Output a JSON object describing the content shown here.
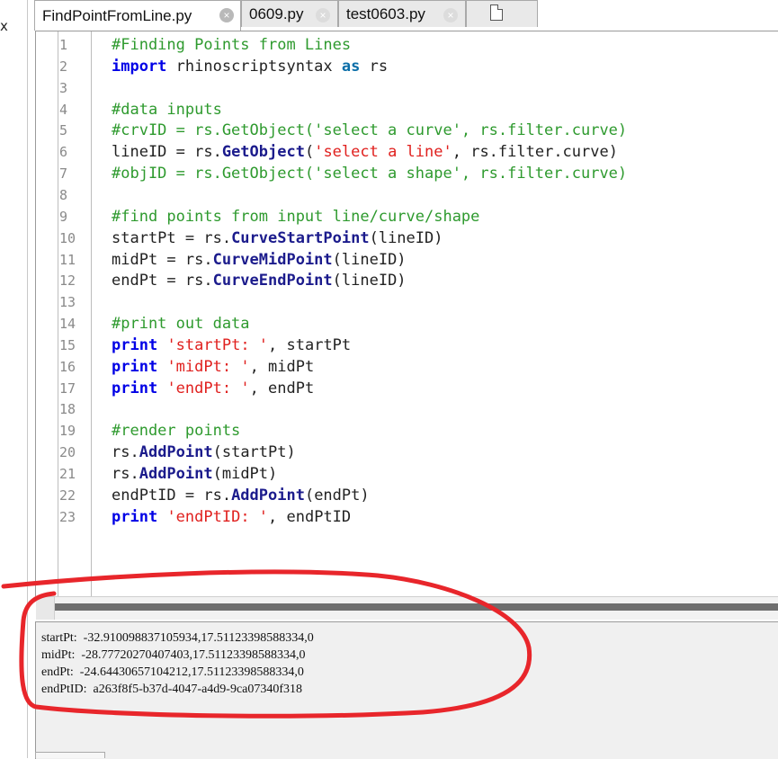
{
  "left_panel": {
    "close_glyph": "x"
  },
  "tabs": [
    {
      "label": "FindPointFromLine.py",
      "active": true
    },
    {
      "label": "0609.py",
      "active": false
    },
    {
      "label": "test0603.py",
      "active": false
    }
  ],
  "icons": {
    "tab_close": "close-circle-icon",
    "new_tab": "new-document-icon"
  },
  "editor": {
    "lines": [
      {
        "n": "1",
        "tokens": [
          {
            "t": "#Finding Points from Lines",
            "c": "cm"
          }
        ]
      },
      {
        "n": "2",
        "tokens": [
          {
            "t": "import",
            "c": "kw"
          },
          {
            "t": " rhinoscriptsyntax ",
            "c": "plain"
          },
          {
            "t": "as",
            "c": "kwb"
          },
          {
            "t": " rs",
            "c": "plain"
          }
        ]
      },
      {
        "n": "3",
        "tokens": []
      },
      {
        "n": "4",
        "tokens": [
          {
            "t": "#data inputs",
            "c": "cm"
          }
        ]
      },
      {
        "n": "5",
        "tokens": [
          {
            "t": "#crvID = rs.GetObject('select a curve', rs.filter.curve)",
            "c": "cm"
          }
        ]
      },
      {
        "n": "6",
        "tokens": [
          {
            "t": "lineID = rs.",
            "c": "plain"
          },
          {
            "t": "GetObject",
            "c": "fn"
          },
          {
            "t": "(",
            "c": "plain"
          },
          {
            "t": "'select a line'",
            "c": "str"
          },
          {
            "t": ", rs.filter.curve)",
            "c": "plain"
          }
        ]
      },
      {
        "n": "7",
        "tokens": [
          {
            "t": "#objID = rs.GetObject('select a shape', rs.filter.curve)",
            "c": "cm"
          }
        ]
      },
      {
        "n": "8",
        "tokens": []
      },
      {
        "n": "9",
        "tokens": [
          {
            "t": "#find points from input line/curve/shape",
            "c": "cm"
          }
        ]
      },
      {
        "n": "10",
        "tokens": [
          {
            "t": "startPt = rs.",
            "c": "plain"
          },
          {
            "t": "CurveStartPoint",
            "c": "fn"
          },
          {
            "t": "(lineID)",
            "c": "plain"
          }
        ]
      },
      {
        "n": "11",
        "tokens": [
          {
            "t": "midPt = rs.",
            "c": "plain"
          },
          {
            "t": "CurveMidPoint",
            "c": "fn"
          },
          {
            "t": "(lineID)",
            "c": "plain"
          }
        ]
      },
      {
        "n": "12",
        "tokens": [
          {
            "t": "endPt = rs.",
            "c": "plain"
          },
          {
            "t": "CurveEndPoint",
            "c": "fn"
          },
          {
            "t": "(lineID)",
            "c": "plain"
          }
        ]
      },
      {
        "n": "13",
        "tokens": []
      },
      {
        "n": "14",
        "tokens": [
          {
            "t": "#print out data",
            "c": "cm"
          }
        ]
      },
      {
        "n": "15",
        "tokens": [
          {
            "t": "print",
            "c": "kw"
          },
          {
            "t": " ",
            "c": "plain"
          },
          {
            "t": "'startPt: '",
            "c": "str"
          },
          {
            "t": ", startPt",
            "c": "plain"
          }
        ]
      },
      {
        "n": "16",
        "tokens": [
          {
            "t": "print",
            "c": "kw"
          },
          {
            "t": " ",
            "c": "plain"
          },
          {
            "t": "'midPt: '",
            "c": "str"
          },
          {
            "t": ", midPt",
            "c": "plain"
          }
        ]
      },
      {
        "n": "17",
        "tokens": [
          {
            "t": "print",
            "c": "kw"
          },
          {
            "t": " ",
            "c": "plain"
          },
          {
            "t": "'endPt: '",
            "c": "str"
          },
          {
            "t": ", endPt",
            "c": "plain"
          }
        ]
      },
      {
        "n": "18",
        "tokens": []
      },
      {
        "n": "19",
        "tokens": [
          {
            "t": "#render points",
            "c": "cm"
          }
        ]
      },
      {
        "n": "20",
        "tokens": [
          {
            "t": "rs.",
            "c": "plain"
          },
          {
            "t": "AddPoint",
            "c": "fn"
          },
          {
            "t": "(startPt)",
            "c": "plain"
          }
        ]
      },
      {
        "n": "21",
        "tokens": [
          {
            "t": "rs.",
            "c": "plain"
          },
          {
            "t": "AddPoint",
            "c": "fn"
          },
          {
            "t": "(midPt)",
            "c": "plain"
          }
        ]
      },
      {
        "n": "22",
        "tokens": [
          {
            "t": "endPtID = rs.",
            "c": "plain"
          },
          {
            "t": "AddPoint",
            "c": "fn"
          },
          {
            "t": "(endPt)",
            "c": "plain"
          }
        ]
      },
      {
        "n": "23",
        "tokens": [
          {
            "t": "print",
            "c": "kw"
          },
          {
            "t": " ",
            "c": "plain"
          },
          {
            "t": "'endPtID: '",
            "c": "str"
          },
          {
            "t": ", endPtID",
            "c": "plain"
          }
        ]
      }
    ]
  },
  "output": {
    "lines": [
      "startPt:  -32.910098837105934,17.51123398588334,0",
      "midPt:  -28.77720270407403,17.51123398588334,0",
      "endPt:  -24.64430657104212,17.51123398588334,0",
      "endPtID:  a263f8f5-b37d-4047-a4d9-9ca07340f318"
    ]
  },
  "colors": {
    "comment": "#2e9a2e",
    "keyword": "#0000e6",
    "string": "#e0201e",
    "function": "#1b1b8c",
    "annotation": "#e8262b"
  }
}
